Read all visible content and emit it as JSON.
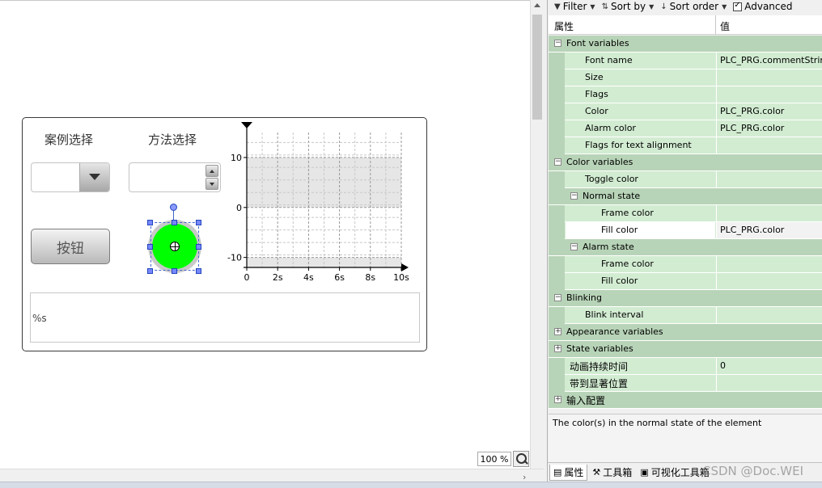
{
  "canvas": {
    "label_case": "案例选择",
    "label_method": "方法选择",
    "button_label": "按钮",
    "textfield_text": "%s",
    "zoom_value": "100 %"
  },
  "trend_chart": {
    "type": "line",
    "x_ticks": [
      "0",
      "2s",
      "4s",
      "6s",
      "8s",
      "10s"
    ],
    "y_ticks": [
      "10",
      "0",
      "-10"
    ],
    "xlim": [
      0,
      10
    ],
    "ylim": [
      -12,
      15
    ],
    "shaded_band": [
      0,
      10
    ],
    "grid": true
  },
  "toolbar": {
    "filter": "Filter",
    "sort_by": "Sort by",
    "sort_order": "Sort order",
    "advanced": "Advanced"
  },
  "grid_header": {
    "col_property": "属性",
    "col_value": "值"
  },
  "rows": [
    {
      "kind": "cat",
      "depth": 0,
      "expander": "−",
      "label": "Font variables",
      "value": ""
    },
    {
      "kind": "prop",
      "depth": 1,
      "label": "Font name",
      "value": "PLC_PRG.commentString"
    },
    {
      "kind": "prop",
      "depth": 1,
      "label": "Size",
      "value": ""
    },
    {
      "kind": "prop",
      "depth": 1,
      "label": "Flags",
      "value": ""
    },
    {
      "kind": "prop",
      "depth": 1,
      "label": "Color",
      "value": "PLC_PRG.color"
    },
    {
      "kind": "prop",
      "depth": 1,
      "label": "Alarm color",
      "value": "PLC_PRG.color"
    },
    {
      "kind": "prop",
      "depth": 1,
      "label": "Flags for text alignment",
      "value": ""
    },
    {
      "kind": "cat",
      "depth": 0,
      "expander": "−",
      "label": "Color variables",
      "value": ""
    },
    {
      "kind": "prop",
      "depth": 1,
      "label": "Toggle color",
      "value": ""
    },
    {
      "kind": "cat",
      "depth": 1,
      "expander": "−",
      "label": "Normal state",
      "value": ""
    },
    {
      "kind": "prop",
      "depth": 2,
      "label": "Frame color",
      "value": ""
    },
    {
      "kind": "prop",
      "depth": 2,
      "label": "Fill color",
      "value": "PLC_PRG.color",
      "selected": true
    },
    {
      "kind": "cat",
      "depth": 1,
      "expander": "−",
      "label": "Alarm state",
      "value": ""
    },
    {
      "kind": "prop",
      "depth": 2,
      "label": "Frame color",
      "value": ""
    },
    {
      "kind": "prop",
      "depth": 2,
      "label": "Fill color",
      "value": ""
    },
    {
      "kind": "cat",
      "depth": 0,
      "expander": "−",
      "label": "Blinking",
      "value": ""
    },
    {
      "kind": "prop",
      "depth": 1,
      "label": "Blink interval",
      "value": ""
    },
    {
      "kind": "cat",
      "depth": 0,
      "expander": "+",
      "label": "Appearance variables",
      "value": ""
    },
    {
      "kind": "cat",
      "depth": 0,
      "expander": "+",
      "label": "State variables",
      "value": ""
    },
    {
      "kind": "prop",
      "depth": 0,
      "label": "动画持续时间",
      "value": "0"
    },
    {
      "kind": "prop",
      "depth": 0,
      "label": "带到显著位置",
      "value": ""
    },
    {
      "kind": "cat",
      "depth": 0,
      "expander": "+",
      "label": "输入配置",
      "value": ""
    }
  ],
  "description": "The color(s) in the normal state of the element",
  "tabs": [
    {
      "label": "属性",
      "icon": "properties-icon",
      "active": true
    },
    {
      "label": "工具箱",
      "icon": "toolbox-icon",
      "active": false
    },
    {
      "label": "可视化工具箱",
      "icon": "visualization-toolbox-icon",
      "active": false
    }
  ],
  "watermark": "CSDN @Doc.WEI",
  "colors": {
    "category_row": "#b8d4b8",
    "property_row": "#d2ecd2",
    "lamp_green": "#00ff00"
  }
}
